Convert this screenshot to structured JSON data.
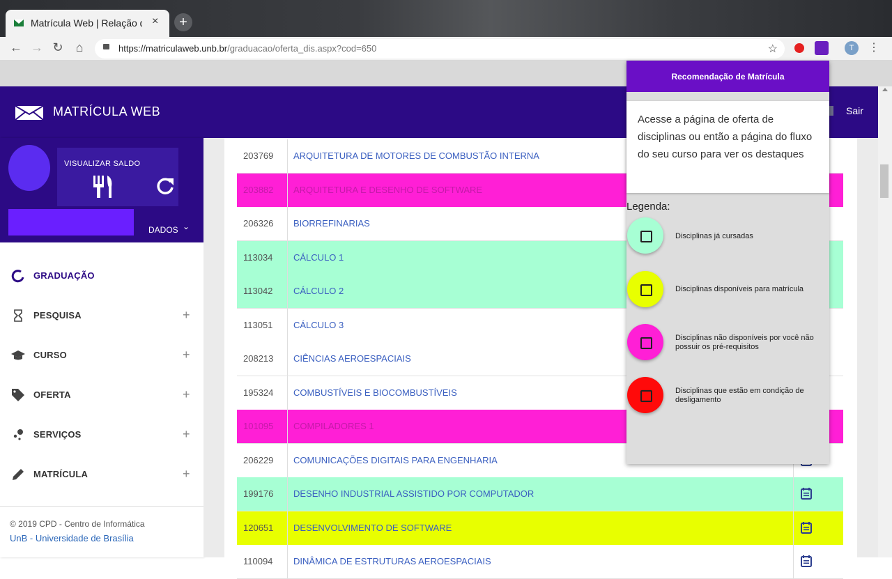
{
  "browser": {
    "tab_title": "Matrícula Web | Relação d",
    "tab_close": "×",
    "new_tab": "+",
    "url_host": "https://matriculaweb.unb.br",
    "url_path": "/graduacao/oferta_dis.aspx?cod=650",
    "profile_initial": "T"
  },
  "app": {
    "title": "MATRÍCULA WEB",
    "logout": "Sair"
  },
  "profile": {
    "saldo_label": "VISUALIZAR SALDO",
    "dados_label": "DADOS"
  },
  "menu": [
    {
      "label": "GRADUAÇÃO",
      "icon": "circle-icon"
    },
    {
      "label": "PESQUISA",
      "icon": "hourglass-icon"
    },
    {
      "label": "CURSO",
      "icon": "graduation-cap-icon"
    },
    {
      "label": "OFERTA",
      "icon": "tag-icon"
    },
    {
      "label": "SERVIÇOS",
      "icon": "services-icon"
    },
    {
      "label": "MATRÍCULA",
      "icon": "pencil-icon"
    }
  ],
  "footer": {
    "line1": "© 2019 CPD - Centro de Informática",
    "line2": "UnB - Universidade de Brasília"
  },
  "rows": [
    {
      "code": "203769",
      "name": "ARQUITETURA DE MOTORES DE COMBUSTÃO INTERNA",
      "status": "white"
    },
    {
      "code": "203882",
      "name": "ARQUITETURA E DESENHO DE SOFTWARE",
      "status": "magenta"
    },
    {
      "code": "206326",
      "name": "BIORREFINARIAS",
      "status": "white"
    },
    {
      "code": "113034",
      "name": "CÁLCULO 1",
      "status": "green"
    },
    {
      "code": "113042",
      "name": "CÁLCULO 2",
      "status": "green"
    },
    {
      "code": "113051",
      "name": "CÁLCULO 3",
      "status": "white"
    },
    {
      "code": "208213",
      "name": "CIÊNCIAS AEROESPACIAIS",
      "status": "white"
    },
    {
      "code": "195324",
      "name": "COMBUSTÍVEIS E BIOCOMBUSTÍVEIS",
      "status": "white"
    },
    {
      "code": "101095",
      "name": "COMPILADORES 1",
      "status": "magenta"
    },
    {
      "code": "206229",
      "name": "COMUNICAÇÕES DIGITAIS PARA ENGENHARIA",
      "status": "white"
    },
    {
      "code": "199176",
      "name": "DESENHO INDUSTRIAL ASSISTIDO POR COMPUTADOR",
      "status": "green"
    },
    {
      "code": "120651",
      "name": "DESENVOLVIMENTO DE SOFTWARE",
      "status": "yellow"
    },
    {
      "code": "110094",
      "name": "DINÂMICA DE ESTRUTURAS AEROESPACIAIS",
      "status": "white"
    }
  ],
  "popup": {
    "title": "Recomendação de Matrícula",
    "message": "Acesse a página de oferta de disciplinas ou então a página do fluxo do seu curso para ver os destaques",
    "legend_label": "Legenda:",
    "legend": [
      {
        "text": "Disciplinas já cursadas",
        "color": "#a7ffd4"
      },
      {
        "text": "Disciplinas disponíveis para matrícula",
        "color": "#e8ff00"
      },
      {
        "text": "Disciplinas não disponíveis por você não possuir os pré-requisitos",
        "color": "#ff1fd6"
      },
      {
        "text": "Disciplinas que estão em condição de desligamento",
        "color": "#ff0a0a"
      }
    ]
  },
  "colors": {
    "brand": "#2c0a85",
    "popup_header": "#6a0fc6",
    "completed": "#a7ffd4",
    "available": "#e8ff00",
    "unavailable": "#ff1fd6",
    "dismissal": "#ff0a0a"
  }
}
